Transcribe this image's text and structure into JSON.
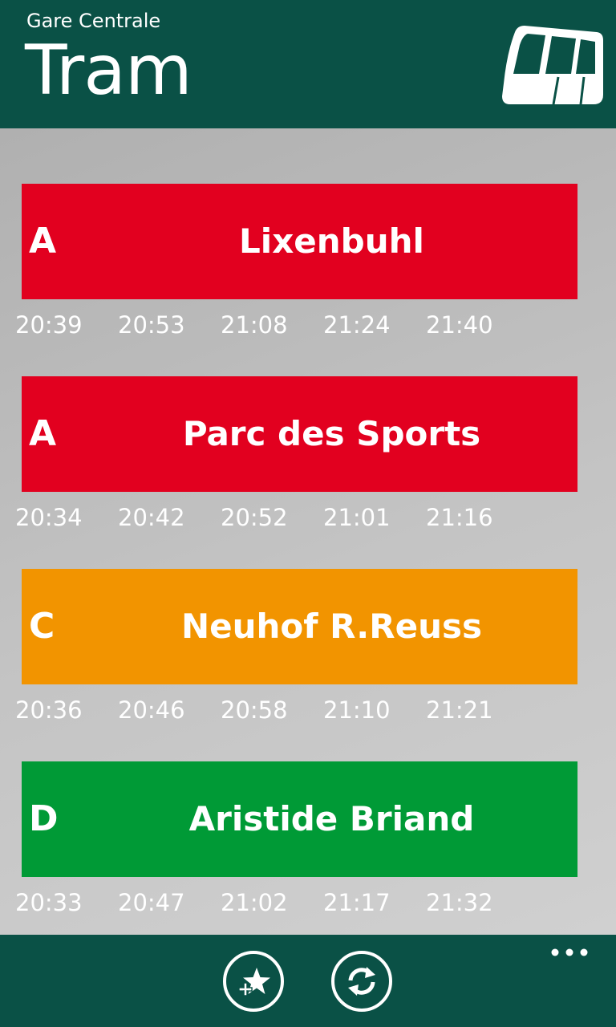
{
  "header": {
    "station": "Gare Centrale",
    "title": "Tram",
    "icon": "tram-icon"
  },
  "departures": [
    {
      "line": "A",
      "destination": "Lixenbuhl",
      "color": "#e2001f",
      "times": [
        "20:39",
        "20:53",
        "21:08",
        "21:24",
        "21:40"
      ]
    },
    {
      "line": "A",
      "destination": "Parc des Sports",
      "color": "#e2001f",
      "times": [
        "20:34",
        "20:42",
        "20:52",
        "21:01",
        "21:16"
      ]
    },
    {
      "line": "C",
      "destination": "Neuhof R.Reuss",
      "color": "#f29400",
      "times": [
        "20:36",
        "20:46",
        "20:58",
        "21:10",
        "21:21"
      ]
    },
    {
      "line": "D",
      "destination": "Aristide Briand",
      "color": "#009a36",
      "times": [
        "20:33",
        "20:47",
        "21:02",
        "21:17",
        "21:32"
      ]
    }
  ],
  "appbar": {
    "buttons": [
      {
        "name": "add-favorite-button",
        "icon": "star-plus-icon"
      },
      {
        "name": "refresh-button",
        "icon": "refresh-icon"
      }
    ],
    "more_icon": "more-dots-icon"
  },
  "colors": {
    "header_bg": "#0a5146",
    "appbar_bg": "#0a5146",
    "line_a": "#e2001f",
    "line_c": "#f29400",
    "line_d": "#009a36"
  }
}
